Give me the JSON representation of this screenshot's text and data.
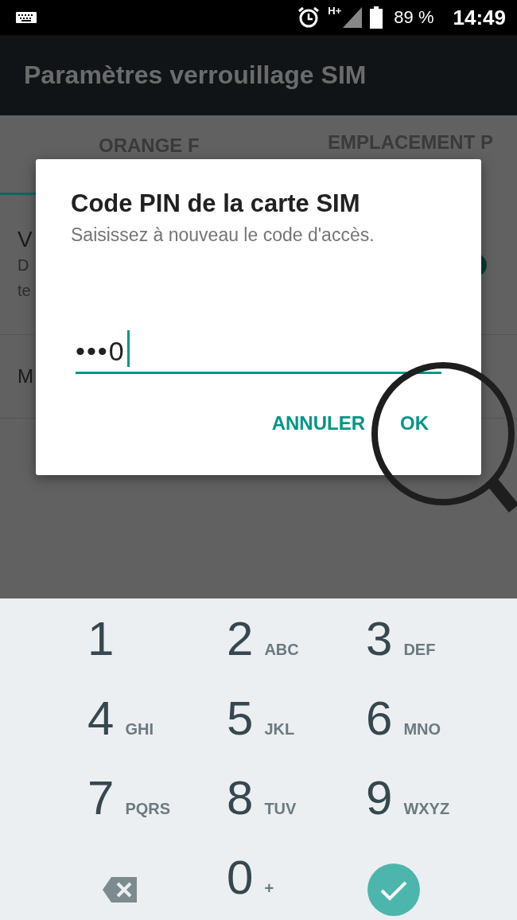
{
  "status_bar": {
    "network": "H+",
    "battery": "89 %",
    "time": "14:49"
  },
  "toolbar": {
    "title": "Paramètres verrouillage SIM"
  },
  "tabs": [
    {
      "label": "ORANGE F",
      "selected": true
    },
    {
      "label": "EMPLACEMENT P",
      "selected": false
    }
  ],
  "settings": [
    {
      "title": "V",
      "summary": [
        "D",
        "te"
      ],
      "toggle": {
        "on": true
      }
    },
    {
      "title": "M"
    }
  ],
  "dialog": {
    "title": "Code PIN de la carte SIM",
    "message": "Saisissez à nouveau le code d'accès.",
    "value": "•••0",
    "buttons": [
      "ANNULER",
      "OK"
    ]
  },
  "keypad": [
    {
      "kind": "digit",
      "digit": "1"
    },
    {
      "kind": "digit",
      "digit": "2",
      "letters": "ABC"
    },
    {
      "kind": "digit",
      "digit": "3",
      "letters": "DEF"
    },
    {
      "kind": "digit",
      "digit": "4",
      "letters": "GHI"
    },
    {
      "kind": "digit",
      "digit": "5",
      "letters": "JKL"
    },
    {
      "kind": "digit",
      "digit": "6",
      "letters": "MNO"
    },
    {
      "kind": "digit",
      "digit": "7",
      "letters": "PQRS"
    },
    {
      "kind": "digit",
      "digit": "8",
      "letters": "TUV"
    },
    {
      "kind": "digit",
      "digit": "9",
      "letters": "WXYZ"
    },
    {
      "kind": "backspace"
    },
    {
      "kind": "digit",
      "digit": "0",
      "letters": "+"
    },
    {
      "kind": "confirm"
    }
  ]
}
